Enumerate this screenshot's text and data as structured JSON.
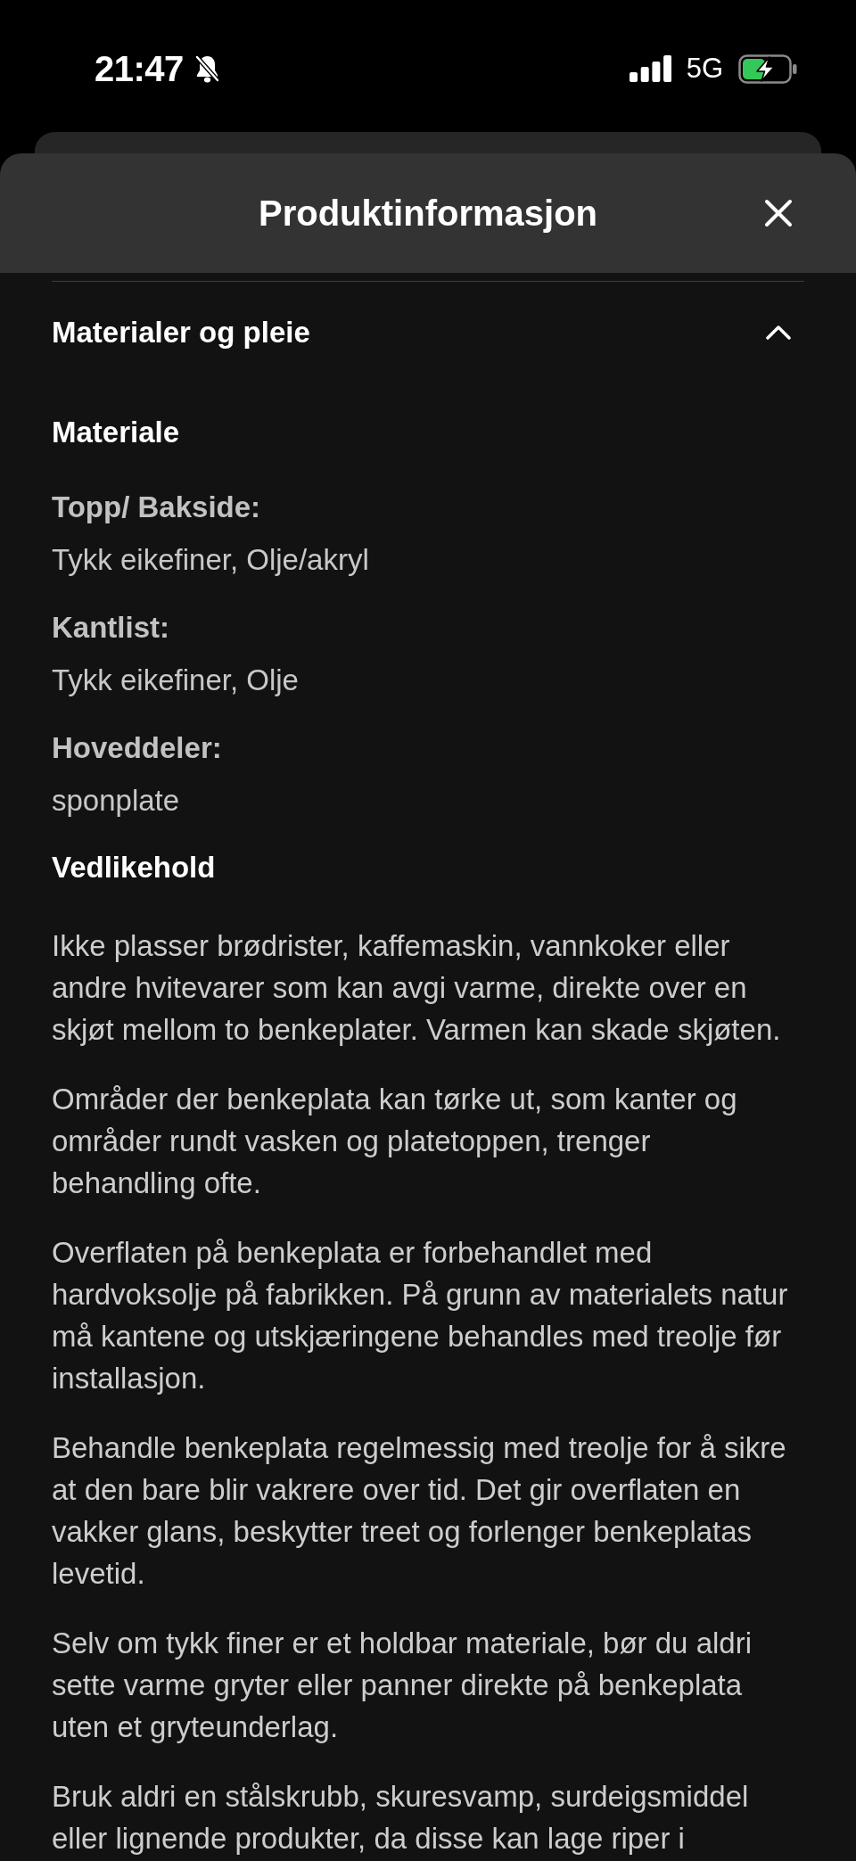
{
  "status_bar": {
    "time": "21:47",
    "network": "5G"
  },
  "sheet": {
    "title": "Produktinformasjon"
  },
  "accordion": {
    "title": "Materialer og pleie",
    "expanded": true,
    "sections": [
      {
        "heading": "Materiale",
        "items": [
          {
            "kind": "field",
            "label": "Topp/ Bakside:",
            "value": "Tykk eikefiner, Olje/akryl"
          },
          {
            "kind": "field",
            "label": "Kantlist:",
            "value": "Tykk eikefiner, Olje"
          },
          {
            "kind": "field",
            "label": "Hoveddeler:",
            "value": "sponplate"
          }
        ]
      },
      {
        "heading": "Vedlikehold",
        "items": [
          {
            "kind": "paragraph",
            "text": "Ikke plasser brødrister, kaffemaskin, vannkoker eller andre hvitevarer som kan avgi varme, direkte over en skjøt mellom to benkeplater. Varmen kan skade skjøten."
          },
          {
            "kind": "paragraph",
            "text": "Områder der benkeplata kan tørke ut, som kanter og områder rundt vasken og platetoppen, trenger behandling ofte."
          },
          {
            "kind": "paragraph",
            "text": "Overflaten på benkeplata er forbehandlet med hardvoksolje på fabrikken. På grunn av materialets natur må kantene og utskjæringene behandles med treolje før installasjon."
          },
          {
            "kind": "paragraph",
            "text": "Behandle benkeplata regelmessig med treolje for å sikre at den bare blir vakrere over tid. Det gir overflaten en vakker glans, beskytter treet og forlenger benkeplatas levetid."
          },
          {
            "kind": "paragraph",
            "text": "Selv om tykk finer er et holdbar materiale, bør du aldri sette varme gryter eller panner direkte på benkeplata uten et gryteunderlag."
          },
          {
            "kind": "paragraph",
            "text": "Bruk aldri en stålskrubb, skuresvamp, surdeigsmiddel eller lignende produkter, da disse kan lage riper i"
          }
        ]
      }
    ]
  }
}
